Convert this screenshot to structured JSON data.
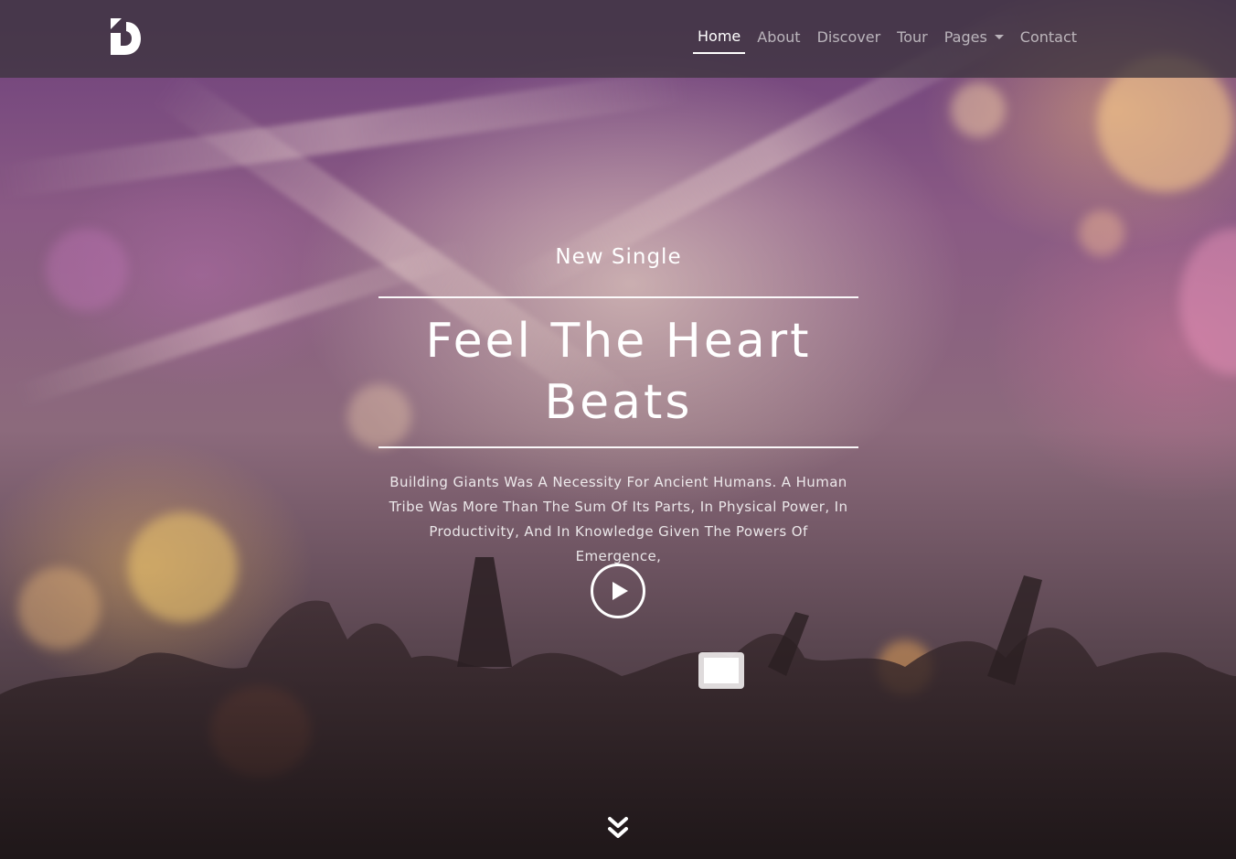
{
  "navbar": {
    "logo_icon": "d-logo-icon",
    "items": [
      {
        "label": "Home",
        "active": true
      },
      {
        "label": "About",
        "active": false
      },
      {
        "label": "Discover",
        "active": false
      },
      {
        "label": "Tour",
        "active": false
      },
      {
        "label": "Pages",
        "active": false,
        "has_dropdown": true
      },
      {
        "label": "Contact",
        "active": false
      }
    ]
  },
  "hero": {
    "kicker": "New Single",
    "title": "Feel The Heart Beats",
    "description": "Building Giants Was A Necessity For Ancient Humans. A Human Tribe Was More Than The Sum Of Its Parts, In Physical Power, In Productivity, And In Knowledge Given The Powers Of Emergence,",
    "play_icon": "play-icon",
    "scroll_icon": "double-chevron-down-icon"
  },
  "colors": {
    "navbar_bg": "#3c343e",
    "text": "#ffffff",
    "nav_inactive": "#c8c2ca"
  }
}
